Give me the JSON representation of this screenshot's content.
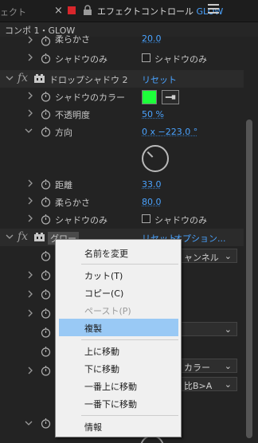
{
  "tabbar": {
    "partial_tab": "ェクト",
    "close_glyph": "×",
    "title_prefix": "エフェクトコントロール",
    "title_layer": "GLOW",
    "tab_color": "#d8262b"
  },
  "subheader": {
    "text": "コンポ 1・GLOW"
  },
  "rows": [
    {
      "label": "柔らかさ",
      "value": "20.0"
    },
    {
      "label": "シャドウのみ",
      "checkbox_label": "シャドウのみ"
    },
    {
      "fx_name": "ドロップシャドウ 2",
      "reset": "リセット"
    },
    {
      "label": "シャドウのカラー",
      "color": "#1dff3a"
    },
    {
      "label": "不透明度",
      "value": "50 %"
    },
    {
      "label": "方向",
      "value": "0 x −223.0 °"
    },
    {
      "label": "距離",
      "value": "33.0"
    },
    {
      "label": "柔らかさ",
      "value": "80.0"
    },
    {
      "label": "シャドウのみ",
      "checkbox_label": "シャドウのみ"
    },
    {
      "fx_name": "グロー",
      "reset": "リセット",
      "options": "オプション..."
    }
  ],
  "right_controls": {
    "channel_dd": "ャンネル",
    "color_dd": "カラー",
    "blend_dd": "比B>A"
  },
  "context_menu": {
    "items": [
      {
        "label": "名前を変更"
      },
      {
        "label": "カット(T)"
      },
      {
        "label": "コピー(C)"
      },
      {
        "label": "ペースト(P)"
      },
      {
        "label": "複製"
      },
      {
        "label": "上に移動"
      },
      {
        "label": "下に移動"
      },
      {
        "label": "一番上に移動"
      },
      {
        "label": "一番下に移動"
      },
      {
        "label": "情報"
      }
    ]
  },
  "colors": {
    "accent_blue": "#4aa3ff",
    "menu_highlight": "#99c9f5",
    "panel_bg": "#232323"
  }
}
